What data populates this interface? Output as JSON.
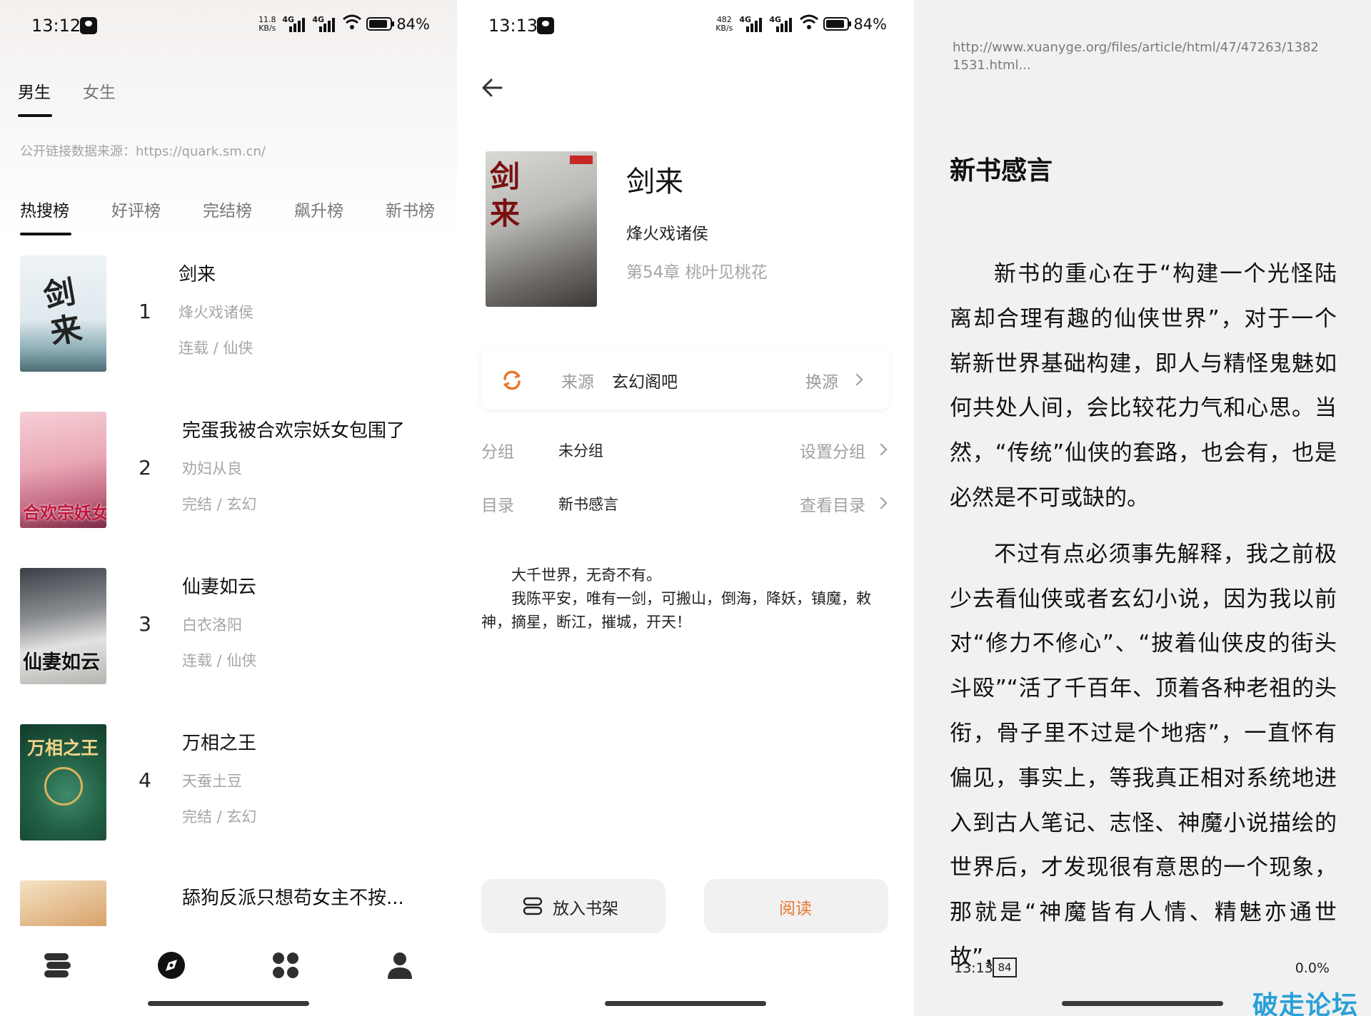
{
  "status_left": {
    "time": "13:12",
    "speed": "11.8 KB/s",
    "net1": "4G",
    "net2": "4G",
    "battery": "84%"
  },
  "status_mid": {
    "time": "13:13",
    "speed": "482 KB/s",
    "net1": "4G",
    "net2": "4G",
    "battery": "84%"
  },
  "ranking": {
    "gender_tabs": [
      "男生",
      "女生"
    ],
    "source_note": "公开链接数据来源：https://quark.sm.cn/",
    "rank_tabs": [
      "热搜榜",
      "好评榜",
      "完结榜",
      "飙升榜",
      "新书榜"
    ],
    "books": [
      {
        "rank": "1",
        "title": "剑来",
        "author": "烽火戏诸侯",
        "meta": "连载 / 仙侠",
        "cover_text": "剑来"
      },
      {
        "rank": "2",
        "title": "完蛋我被合欢宗妖女包围了",
        "author": "劝妇从良",
        "meta": "完结 / 玄幻",
        "cover_text": "合欢宗妖女"
      },
      {
        "rank": "3",
        "title": "仙妻如云",
        "author": "白衣洛阳",
        "meta": "连载 / 仙侠",
        "cover_text": "仙妻如云"
      },
      {
        "rank": "4",
        "title": "万相之王",
        "author": "天蚕土豆",
        "meta": "完结 / 玄幻",
        "cover_text": "万相之王"
      },
      {
        "rank": "5",
        "title": "舔狗反派只想苟女主不按...",
        "author": "",
        "meta": ""
      }
    ],
    "nav_icons": [
      "bookshelf-icon",
      "discover-icon",
      "apps-icon",
      "profile-icon"
    ]
  },
  "detail": {
    "title": "剑来",
    "author": "烽火戏诸侯",
    "chapter": "第54章 桃叶见桃花",
    "cover_text": "剑来",
    "source_label": "来源",
    "source_name": "玄幻阁吧",
    "switch_source": "换源",
    "group_label": "分组",
    "group_value": "未分组",
    "group_action": "设置分组",
    "toc_label": "目录",
    "toc_value": "新书感言",
    "toc_action": "查看目录",
    "intro_1": "大千世界，无奇不有。",
    "intro_2": "我陈平安，唯有一剑，可搬山，倒海，降妖，镇魔，敕神，摘星，断江，摧城，开天！",
    "btn_shelf": "放入书架",
    "btn_read": "阅读",
    "accent": "#e8772e"
  },
  "reader": {
    "url": "http://www.xuanyge.org/files/article/html/47/47263/13821531.html...",
    "chapter_title": "新书感言",
    "para_1": "新书的重心在于“构建一个光怪陆离却合理有趣的仙侠世界”，对于一个崭新世界基础构建，即人与精怪鬼魅如何共处人间，会比较花力气和心思。当然，“传统”仙侠的套路，也会有，也是必然是不可或缺的。",
    "para_2": "不过有点必须事先解释，我之前极少去看仙侠或者玄幻小说，因为我以前对“修力不修心”、“披着仙侠皮的街头斗殴”“活了千百年、顶着各种老祖的头衔，骨子里不过是个地痞”，一直怀有偏见，事实上，等我真正相对系统地进入到古人笔记、志怪、神魔小说描绘的世界后，才发现很有意思的一个现象，那就是“神魔皆有人情、精魅亦通世故”，",
    "time": "13:13",
    "battery": "84",
    "progress": "0.0%"
  },
  "watermark": "破走论坛"
}
